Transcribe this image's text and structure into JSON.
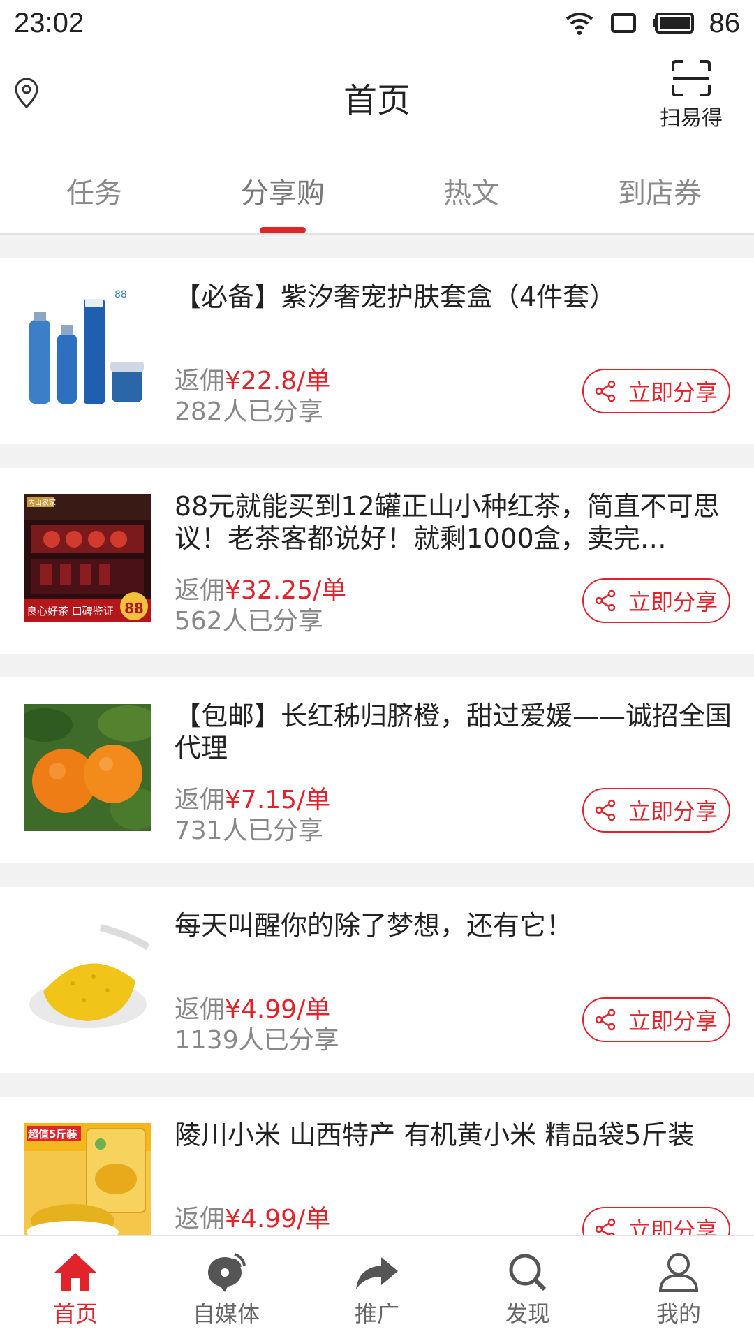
{
  "status_bar": {
    "time": "23:02",
    "battery": "86"
  },
  "header": {
    "title": "首页",
    "scan_label": "扫易得"
  },
  "tabs": [
    {
      "label": "任务",
      "active": false
    },
    {
      "label": "分享购",
      "active": true
    },
    {
      "label": "热文",
      "active": false
    },
    {
      "label": "到店券",
      "active": false
    }
  ],
  "items": [
    {
      "title": "【必备】紫汐奢宠护肤套盒（4件套）",
      "commission_prefix": "返佣",
      "commission": "¥22.8/单",
      "shares": "282人已分享",
      "share_label": "立即分享"
    },
    {
      "title": "88元就能买到12罐正山小种红茶，简直不可思议！老茶客都说好！就剩1000盒，卖完…",
      "commission_prefix": "返佣",
      "commission": "¥32.25/单",
      "shares": "562人已分享",
      "share_label": "立即分享",
      "thumb_text_top": "内山农家",
      "thumb_text_bottom": "良心好茶 口碑鉴证",
      "thumb_price": "88"
    },
    {
      "title": "【包邮】长红秭归脐橙，甜过爱媛——诚招全国代理",
      "commission_prefix": "返佣",
      "commission": "¥7.15/单",
      "shares": "731人已分享",
      "share_label": "立即分享"
    },
    {
      "title": "每天叫醒你的除了梦想，还有它！",
      "commission_prefix": "返佣",
      "commission": "¥4.99/单",
      "shares": "1139人已分享",
      "share_label": "立即分享"
    },
    {
      "title": "陵川小米 山西特产 有机黄小米 精品袋5斤装",
      "commission_prefix": "返佣",
      "commission": "¥4.99/单",
      "shares": "",
      "share_label": "立即分享",
      "thumb_text_top": "超值5斤装"
    }
  ],
  "bottom_nav": [
    {
      "label": "首页",
      "icon": "home-icon",
      "active": true
    },
    {
      "label": "自媒体",
      "icon": "media-icon",
      "active": false
    },
    {
      "label": "推广",
      "icon": "share-arrow-icon",
      "active": false
    },
    {
      "label": "发现",
      "icon": "search-icon",
      "active": false
    },
    {
      "label": "我的",
      "icon": "user-icon",
      "active": false
    }
  ],
  "colors": {
    "accent": "#e1232c",
    "text": "#222222",
    "muted": "#888888",
    "background": "#f2f2f2"
  }
}
